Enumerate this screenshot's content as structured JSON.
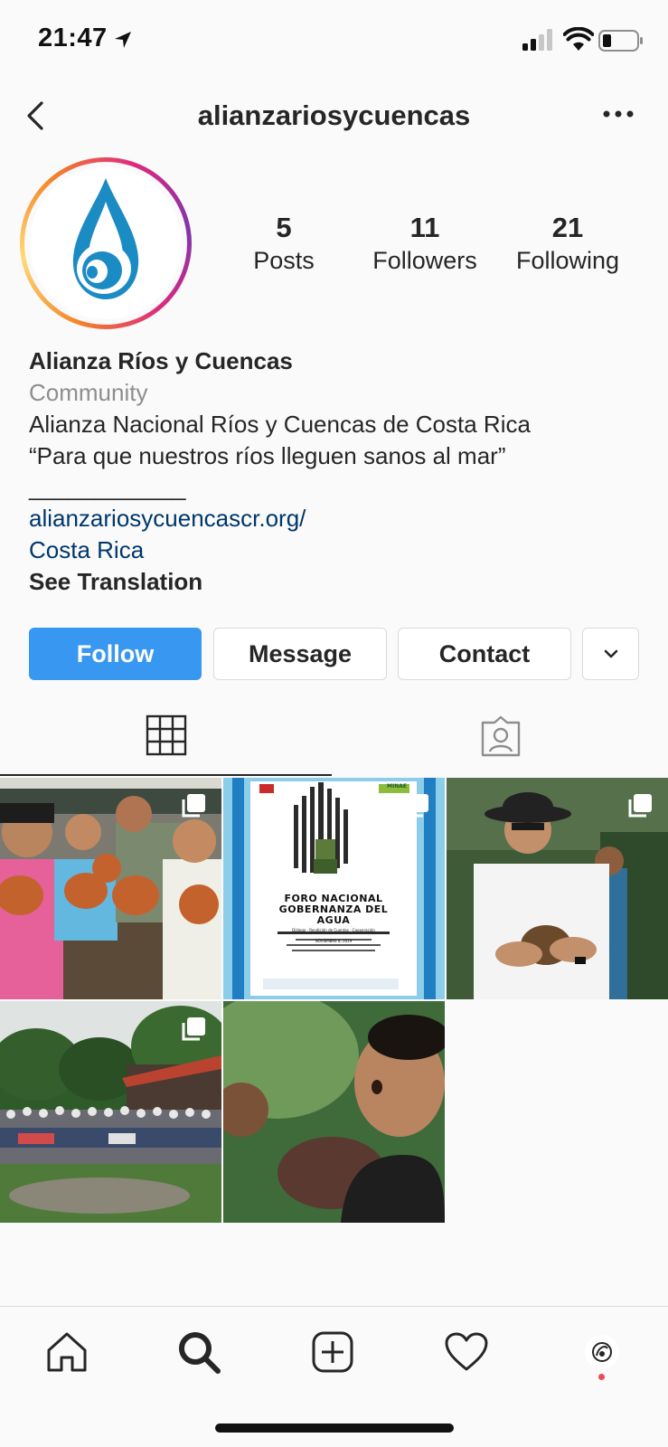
{
  "status_bar": {
    "time": "21:47",
    "icons": [
      "location-arrow-icon",
      "signal-icon",
      "wifi-icon",
      "battery-icon"
    ]
  },
  "header": {
    "username": "alianzariosycuencas",
    "back_icon": "chevron-left-icon",
    "more_icon": "ellipsis-icon"
  },
  "profile": {
    "stats": [
      {
        "value": "5",
        "label": "Posts"
      },
      {
        "value": "11",
        "label": "Followers"
      },
      {
        "value": "21",
        "label": "Following"
      }
    ],
    "name": "Alianza Ríos y Cuencas",
    "category": "Community",
    "bio_lines": [
      "Alianza Nacional Ríos y Cuencas de Costa Rica",
      "“Para que nuestros ríos lleguen sanos al mar”"
    ],
    "divider": "____________",
    "link": "alianzariosycuencascr.org/",
    "location": "Costa Rica",
    "see_translation": "See Translation"
  },
  "actions": {
    "follow": "Follow",
    "message": "Message",
    "contact": "Contact",
    "more_icon": "chevron-down-icon"
  },
  "tabs": [
    {
      "icon": "grid-icon",
      "active": true
    },
    {
      "icon": "tagged-user-icon",
      "active": false
    }
  ],
  "posts": [
    {
      "multi": true
    },
    {
      "multi": true,
      "text_lines": [
        "FORO NACIONAL",
        "GOBERNANZA DEL",
        "AGUA"
      ],
      "subtitle": "Diálogo - Rendición de Cuentas - Cooperación",
      "date": "NOVIEMBRE 8, 2019",
      "badge": "MINAE"
    },
    {
      "multi": true
    },
    {
      "multi": true
    },
    {
      "multi": false
    }
  ],
  "bottom_nav": [
    "home-icon",
    "search-icon",
    "add-post-icon",
    "heart-icon",
    "profile-icon"
  ],
  "colors": {
    "follow_blue": "#3897f0",
    "link_blue": "#00376b",
    "logo_blue": "#1b8bc4",
    "notif_red": "#ed4956"
  }
}
